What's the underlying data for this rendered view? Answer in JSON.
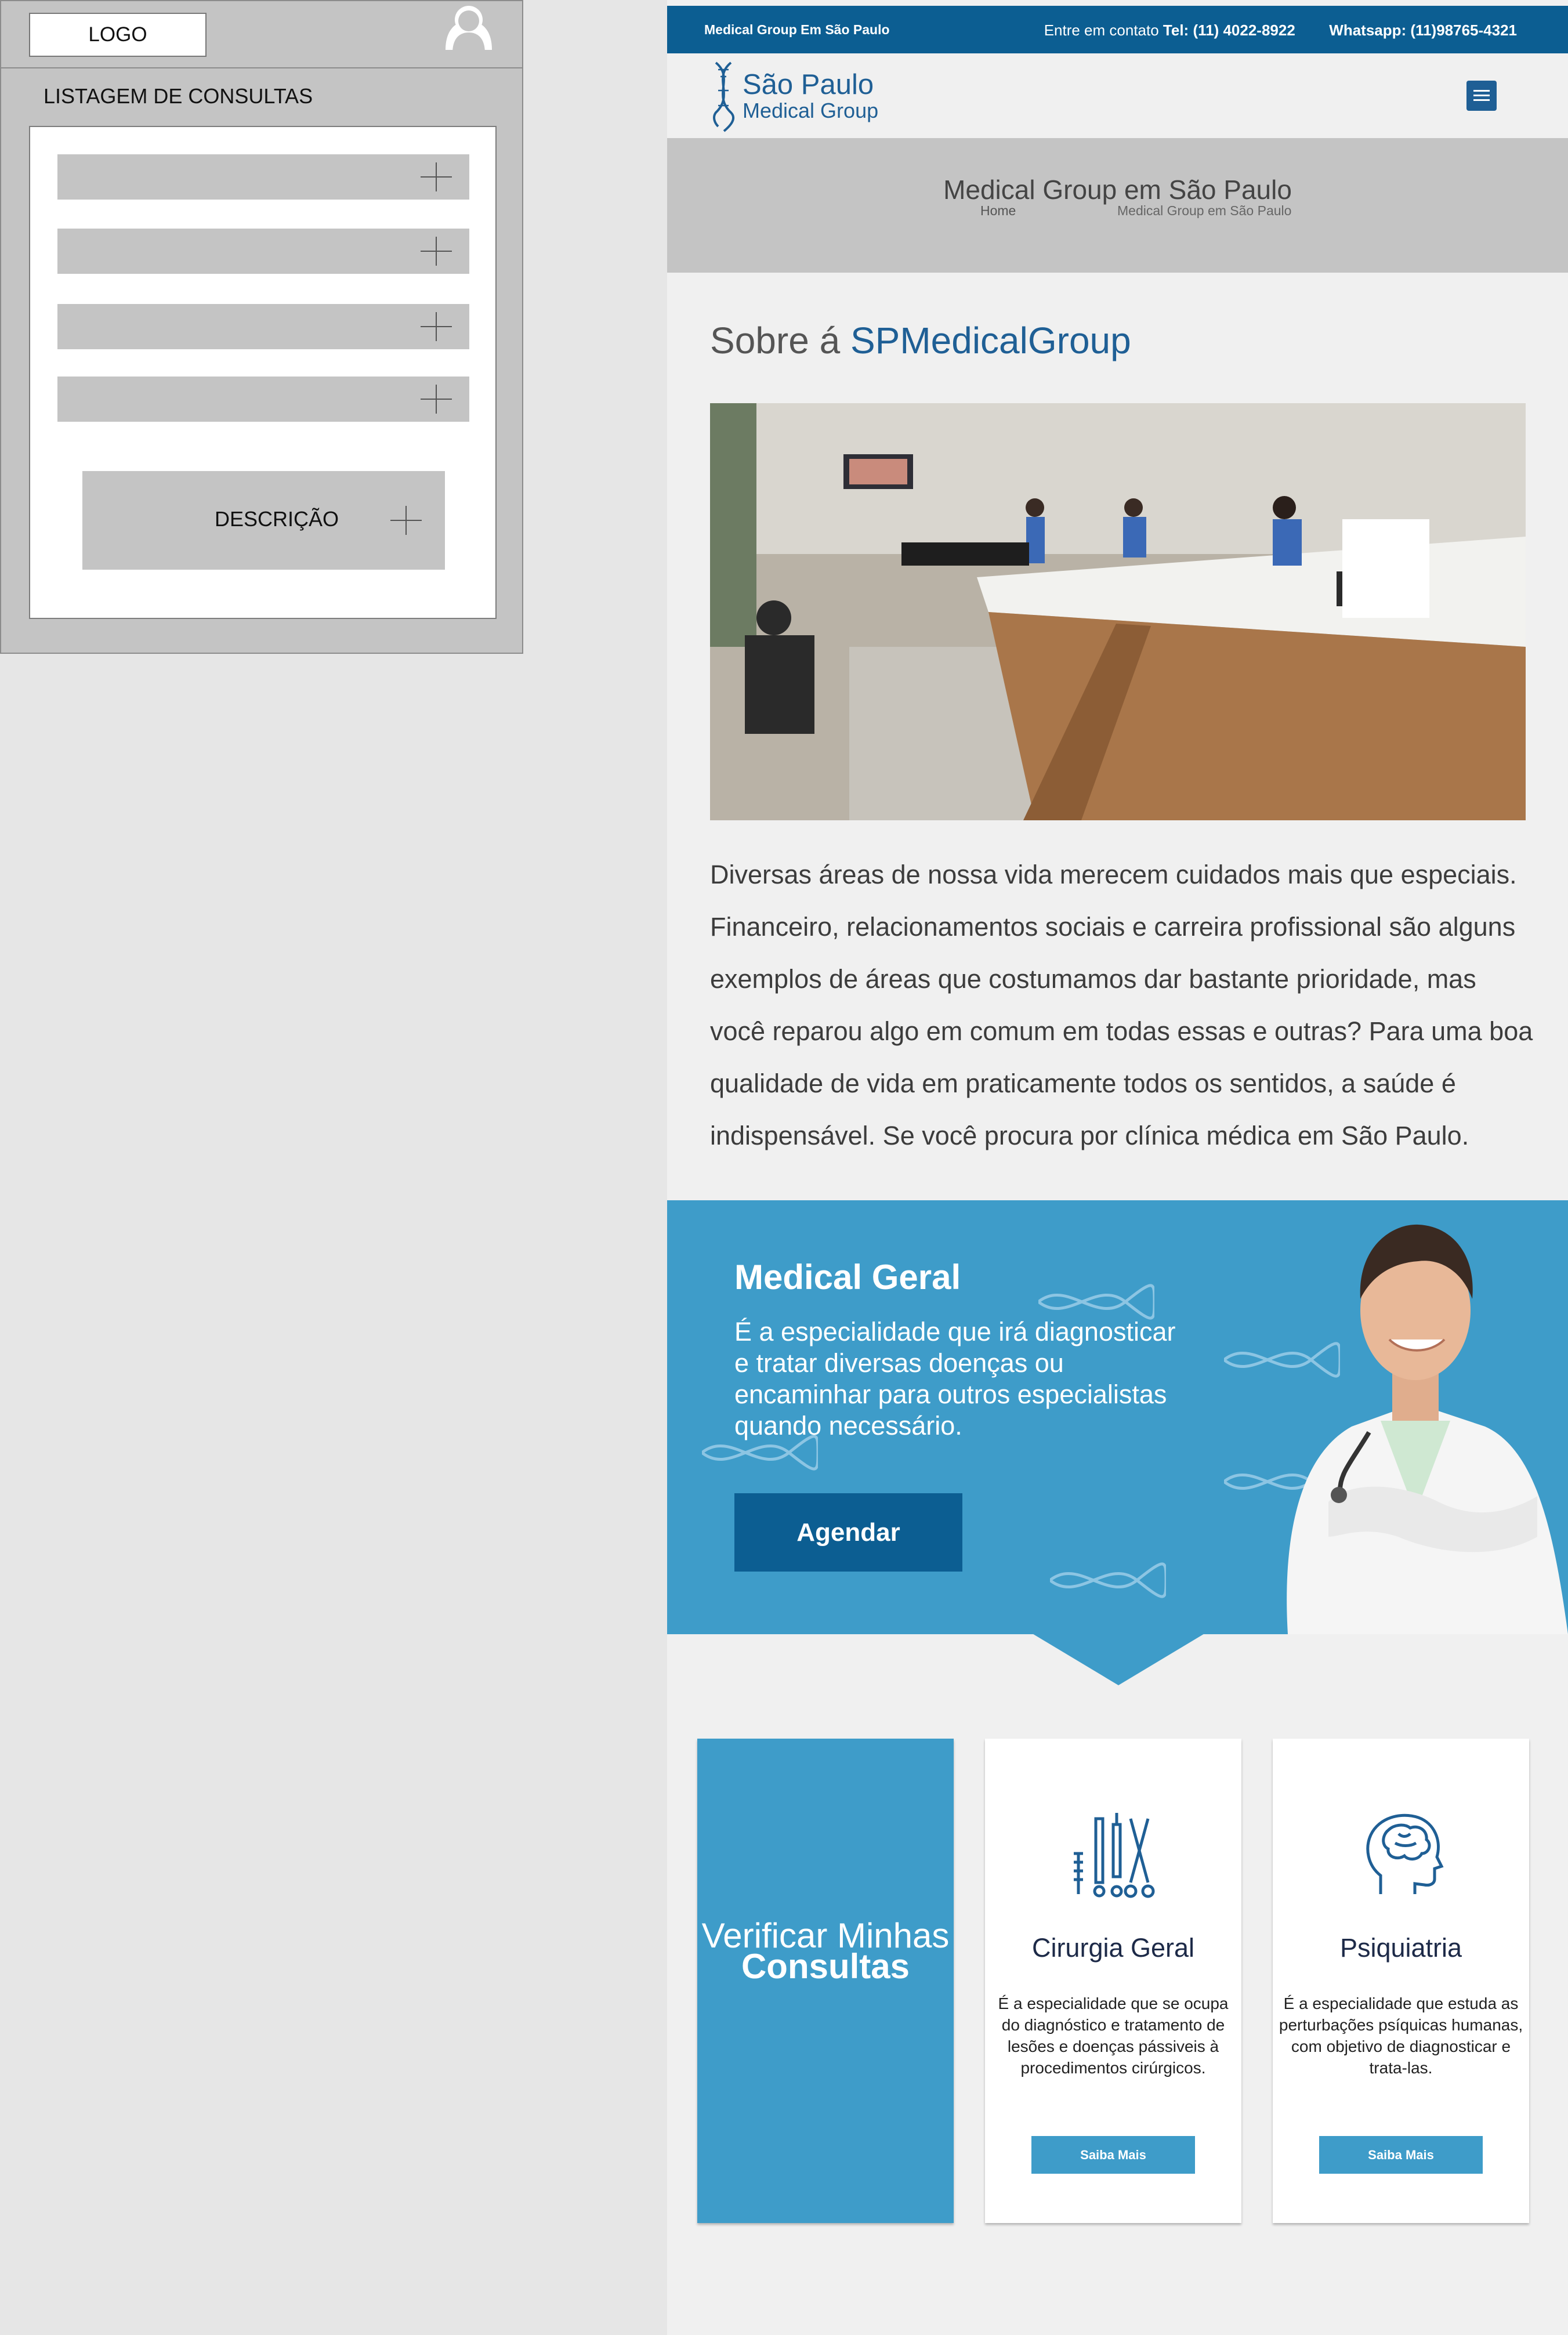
{
  "wireframe": {
    "logo": "LOGO",
    "title": "LISTAGEM DE CONSULTAS",
    "description_label": "DESCRIÇÃO"
  },
  "topbar": {
    "left": "Medical Group Em São Paulo",
    "contact_prefix": "Entre em  contato",
    "tel": "Tel: (11) 4022-8922",
    "whatsapp": "Whatsapp: (11)98765-4321"
  },
  "brand": {
    "line1": "São Paulo",
    "line2": "Medical Group"
  },
  "hero": {
    "title": "Medical Group em São Paulo",
    "breadcrumb_home": "Home",
    "breadcrumb_current": "Medical Group em São Paulo"
  },
  "about": {
    "title_prefix": "Sobre á ",
    "title_accent": "SPMedicalGroup",
    "text": "Diversas áreas de nossa vida merecem cuidados mais que especiais. Financeiro, relacionamentos sociais e carreira profissional são alguns exemplos de áreas que costumamos dar bastante prioridade, mas você reparou algo em comum em todas essas e outras? Para uma boa qualidade de vida em praticamente todos os sentidos, a saúde é indispensável. Se você procura por clínica médica em São Paulo."
  },
  "promo": {
    "title": "Medical Geral",
    "text": "É a especialidade que irá diagnosticar e tratar diversas doenças ou encaminhar para outros especialistas quando necessário.",
    "button": "Agendar"
  },
  "cards": {
    "consultas": {
      "line1": "Verificar Minhas",
      "line2": "Consultas"
    },
    "cirurgia": {
      "title": "Cirurgia Geral",
      "text": "É a especialidade que se ocupa do diagnóstico e tratamento de lesões e doenças pássiveis à procedimentos cirúrgicos.",
      "button": "Saiba Mais"
    },
    "psiquiatria": {
      "title": "Psiquiatria",
      "text": "É a especialidade que estuda as perturbações psíquicas humanas, com objetivo de diagnosticar e trata-las.",
      "button": "Saiba Mais"
    }
  },
  "colors": {
    "primary": "#0c5e92",
    "accent": "#3e9cc9",
    "brand_text": "#1f5f95",
    "gray_band": "#c4c4c4",
    "page_bg": "#f0f0f0"
  },
  "icons": [
    "avatar-icon",
    "plus-icon",
    "dna-logo-icon",
    "hamburger-menu-icon",
    "surgical-tools-icon",
    "brain-head-icon",
    "dna-decoration-icon"
  ]
}
